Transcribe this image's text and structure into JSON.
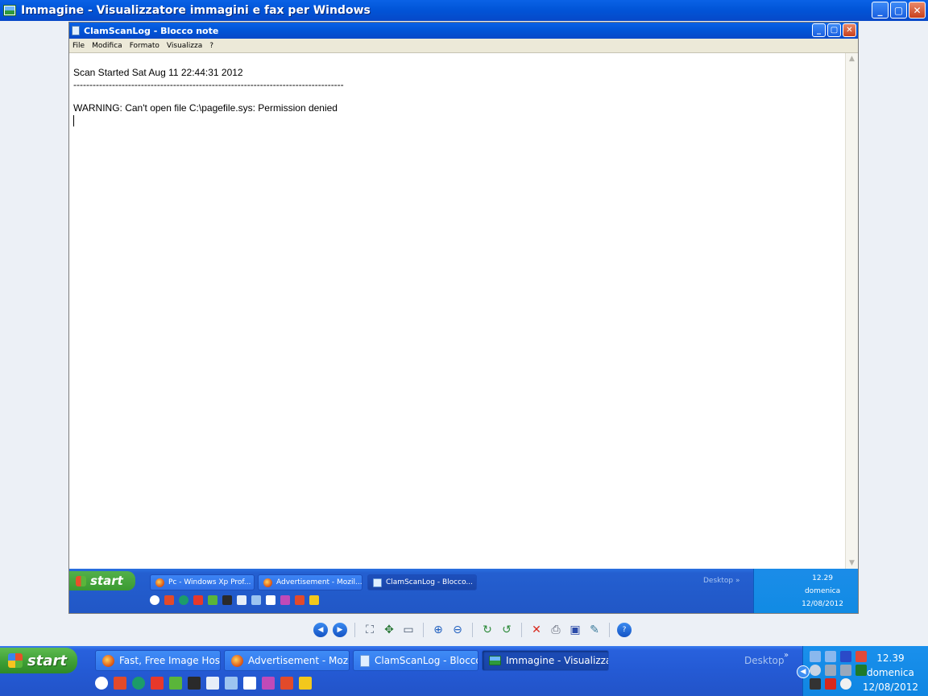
{
  "viewer": {
    "title": "Immagine - Visualizzatore immagini e fax per Windows",
    "controls": {
      "minimize": "_",
      "maximize": "▢",
      "close": "✕"
    }
  },
  "notepad": {
    "title": "ClamScanLog - Blocco note",
    "menu": [
      "File",
      "Modifica",
      "Formato",
      "Visualizza",
      "?"
    ],
    "lines": [
      "Scan Started Sat Aug 11 22:44:31 2012",
      "------------------------------------------------------------------------------------",
      "",
      "WARNING: Can't open file C:\\pagefile.sys: Permission denied"
    ]
  },
  "inner_taskbar": {
    "start_label": "start",
    "tasks": [
      {
        "label": "Pc - Windows Xp Prof..."
      },
      {
        "label": "Advertisement - Mozil..."
      },
      {
        "label": "ClamScanLog - Blocco..."
      }
    ],
    "desktop_label": "Desktop",
    "chevron": "»",
    "clock": {
      "time": "12.29",
      "day": "domenica",
      "date": "12/08/2012"
    }
  },
  "viewer_toolbar": {
    "icons": [
      "previous-image-icon",
      "next-image-icon",
      "best-fit-icon",
      "actual-size-icon",
      "slideshow-icon",
      "zoom-in-icon",
      "zoom-out-icon",
      "rotate-clockwise-icon",
      "rotate-counterclockwise-icon",
      "delete-icon",
      "print-icon",
      "save-icon",
      "edit-icon",
      "help-icon"
    ]
  },
  "taskbar": {
    "start_label": "start",
    "tasks": [
      {
        "label": "Fast, Free Image Hos..."
      },
      {
        "label": "Advertisement - Mozil..."
      },
      {
        "label": "ClamScanLog - Blocco..."
      },
      {
        "label": "Immagine - Visualizza..."
      }
    ],
    "desktop_label": "Desktop",
    "chevron": "»",
    "clock": {
      "time": "12.39",
      "day": "domenica",
      "date": "12/08/2012"
    }
  },
  "colors": {
    "title_bar_blue": "#0155d8",
    "taskbar_blue": "#245ad4",
    "start_green": "#3c9c33",
    "tray_blue": "#0f86e2"
  }
}
